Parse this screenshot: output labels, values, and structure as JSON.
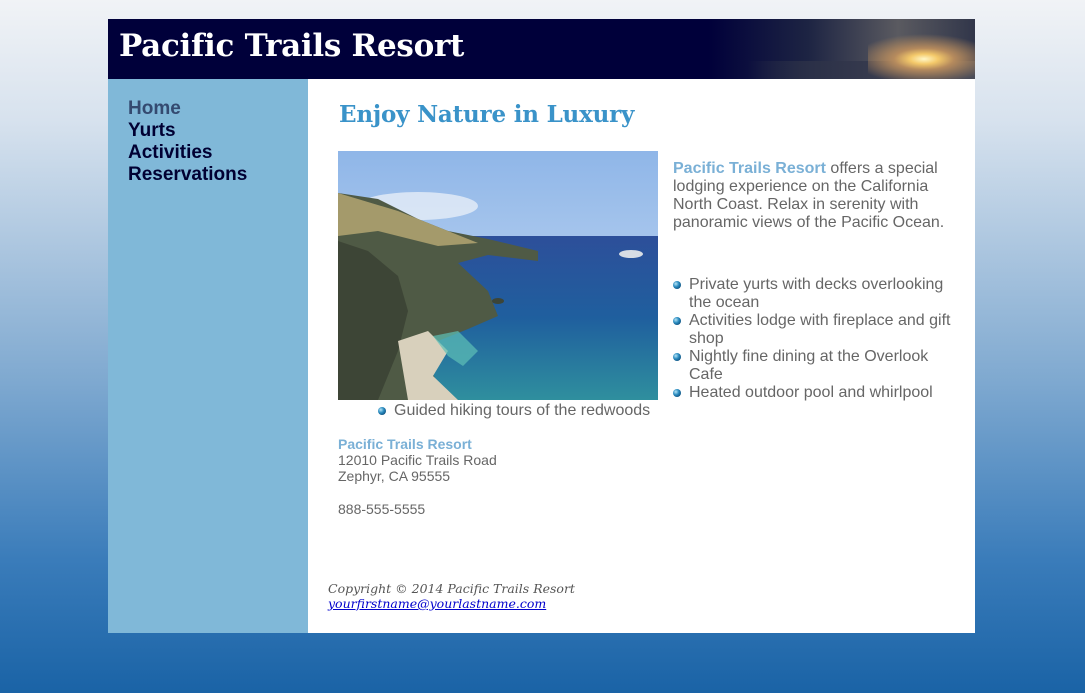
{
  "header": {
    "title": "Pacific Trails Resort"
  },
  "nav": {
    "items": [
      {
        "label": "Home"
      },
      {
        "label": "Yurts"
      },
      {
        "label": "Activities"
      },
      {
        "label": "Reservations"
      }
    ]
  },
  "main": {
    "heading": "Enjoy Nature in Luxury",
    "intro": {
      "resort_name": "Pacific Trails Resort",
      "text": " offers a special lodging experience on the California North Coast. Relax in serenity with panoramic views of the Pacific Ocean."
    },
    "amenities": [
      "Private yurts with decks overlooking the ocean",
      "Activities lodge with fireplace and gift shop",
      "Nightly fine dining at the Overlook Cafe",
      "Heated outdoor pool and whirlpool",
      "Guided hiking tours of the redwoods"
    ],
    "address": {
      "name": "Pacific Trails Resort",
      "street": "12010 Pacific Trails Road",
      "city": "Zephyr, CA 95555"
    },
    "phone": "888-555-5555"
  },
  "footer": {
    "copyright": "Copyright © 2014 Pacific Trails Resort",
    "email": "yourfirstname@yourlastname.com"
  },
  "colors": {
    "header_bg": "#00003a",
    "nav_bg": "#80b8d8",
    "heading": "#3a93c9",
    "resort_name": "#7ab0d6",
    "body_text": "#666666"
  }
}
